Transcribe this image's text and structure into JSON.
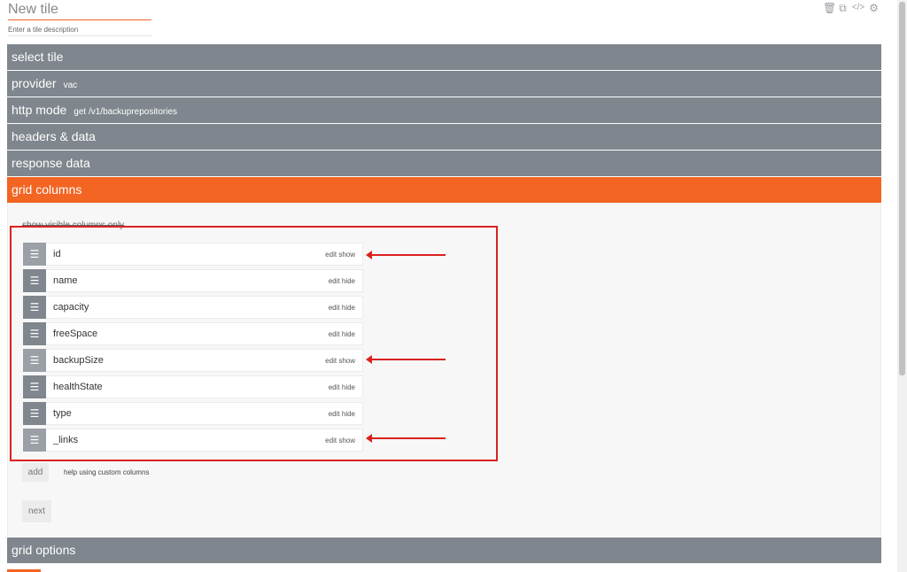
{
  "tile": {
    "title": "New tile",
    "description_placeholder": "Enter a tile description"
  },
  "top_icons": [
    {
      "name": "trash-icon",
      "glyph": "🗑"
    },
    {
      "name": "copy-icon",
      "glyph": "⧉"
    },
    {
      "name": "code-icon",
      "glyph": "</>"
    },
    {
      "name": "gear-icon",
      "glyph": "⚙"
    }
  ],
  "sections": {
    "select_tile": {
      "label": "select tile"
    },
    "provider": {
      "label": "provider",
      "value": "vac"
    },
    "http_mode": {
      "label": "http mode",
      "value": "get /v1/backuprepositories"
    },
    "headers_data": {
      "label": "headers & data"
    },
    "response_data": {
      "label": "response data"
    },
    "grid_columns": {
      "label": "grid columns"
    },
    "grid_options": {
      "label": "grid options"
    }
  },
  "grid_columns": {
    "visible_only_label": "show visible columns only",
    "columns": [
      {
        "name": "id",
        "edit": "edit",
        "toggle": "show"
      },
      {
        "name": "name",
        "edit": "edit",
        "toggle": "hide"
      },
      {
        "name": "capacity",
        "edit": "edit",
        "toggle": "hide"
      },
      {
        "name": "freeSpace",
        "edit": "edit",
        "toggle": "hide"
      },
      {
        "name": "backupSize",
        "edit": "edit",
        "toggle": "show"
      },
      {
        "name": "healthState",
        "edit": "edit",
        "toggle": "hide"
      },
      {
        "name": "type",
        "edit": "edit",
        "toggle": "hide"
      },
      {
        "name": "_links",
        "edit": "edit",
        "toggle": "show"
      }
    ],
    "add_label": "add",
    "help_label": "help using custom columns",
    "next_label": "next"
  },
  "colors": {
    "accent": "#f26522",
    "section_bg": "#7f868d",
    "annotation": "#d9221e"
  }
}
